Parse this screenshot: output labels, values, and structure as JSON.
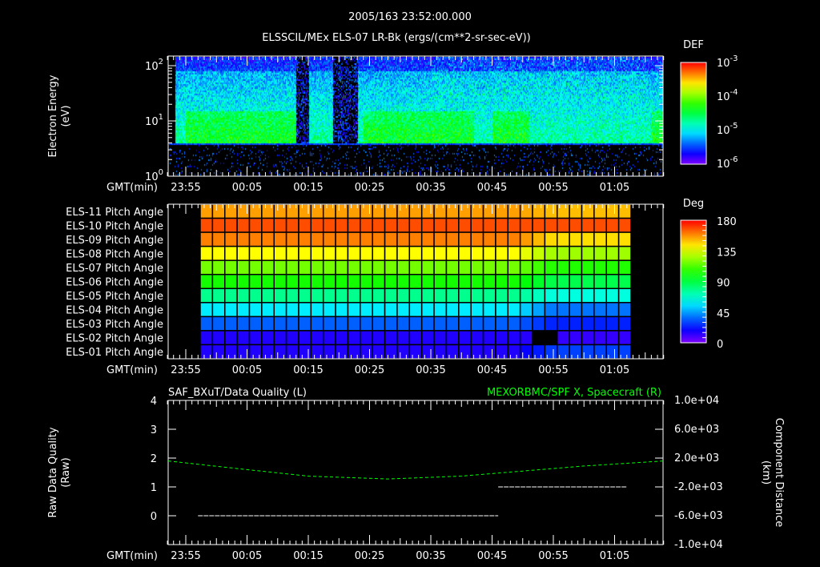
{
  "title": "2005/163 23:52:00.000",
  "chart_data": [
    {
      "type": "heatmap",
      "name": "spectrogram",
      "title": "ELSSCIL/MEx ELS-07 LR-Bk  (ergs/(cm**2-sr-sec-eV))",
      "ylabel": [
        "Electron Energy",
        "(eV)"
      ],
      "xlabel": "GMT(min)",
      "yscale": "log",
      "ylim": [
        1,
        150
      ],
      "yticks": [
        {
          "base": "10",
          "exp": "0",
          "v": 1
        },
        {
          "base": "10",
          "exp": "1",
          "v": 10
        },
        {
          "base": "10",
          "exp": "2",
          "v": 100
        }
      ],
      "xlim_min": [
        -3,
        78
      ],
      "xticks": [
        "23:55",
        "00:05",
        "00:15",
        "00:25",
        "00:35",
        "00:45",
        "00:55",
        "01:05"
      ],
      "colorbar": {
        "label": "DEF",
        "scale": "log",
        "range": [
          1e-06,
          0.001
        ],
        "ticks": [
          {
            "base": "10",
            "exp": "-3"
          },
          {
            "base": "10",
            "exp": "-4"
          },
          {
            "base": "10",
            "exp": "-5"
          },
          {
            "base": "10",
            "exp": "-6"
          }
        ]
      },
      "gaps_min": [
        [
          18,
          20
        ],
        [
          24,
          28
        ]
      ],
      "enhanced_min": [
        [
          0,
          18
        ],
        [
          29,
          47
        ],
        [
          50,
          56
        ],
        [
          76,
          78
        ]
      ]
    },
    {
      "type": "heatmap",
      "name": "pitch-angle",
      "xlabel": "GMT(min)",
      "rows": [
        "ELS-11 Pitch Angle",
        "ELS-10 Pitch Angle",
        "ELS-09 Pitch Angle",
        "ELS-08 Pitch Angle",
        "ELS-07 Pitch Angle",
        "ELS-06 Pitch Angle",
        "ELS-05 Pitch Angle",
        "ELS-04 Pitch Angle",
        "ELS-03 Pitch Angle",
        "ELS-02 Pitch Angle",
        "ELS-01 Pitch Angle"
      ],
      "values_before": [
        155,
        168,
        160,
        140,
        118,
        103,
        78,
        57,
        35,
        15,
        15
      ],
      "values_after": [
        150,
        168,
        145,
        125,
        105,
        88,
        65,
        38,
        25,
        12,
        30
      ],
      "change_min": 58,
      "data_range_min": [
        2,
        72
      ],
      "missing": {
        "row": "ELS-02 Pitch Angle",
        "range_min": [
          56.5,
          60
        ]
      },
      "colorbar": {
        "label": "Deg",
        "range": [
          0,
          180
        ],
        "ticks": [
          "180",
          "135",
          "90",
          "45",
          "0"
        ]
      },
      "xticks": [
        "23:55",
        "00:05",
        "00:15",
        "00:25",
        "00:35",
        "00:45",
        "00:55",
        "01:05"
      ]
    },
    {
      "type": "line",
      "name": "timeseries",
      "title_left": "SAF_BXuT/Data Quality (L)",
      "title_right": "MEXORBMC/SPF X, Spacecraft (R)",
      "ylabel_left": [
        "Raw Data Quality",
        "(Raw)"
      ],
      "ylabel_right": [
        "Component Distance",
        "(km)"
      ],
      "ylim_left": [
        -1,
        4
      ],
      "yticks_left": [
        "4",
        "3",
        "2",
        "1",
        "0"
      ],
      "ylim_right": [
        -10000,
        10000
      ],
      "yticks_right": [
        "1.0e+04",
        "6.0e+03",
        "2.0e+03",
        "-2.0e+03",
        "-6.0e+03",
        "-1.0e+04"
      ],
      "xlabel": "GMT(min)",
      "xticks": [
        "23:55",
        "00:05",
        "00:15",
        "00:25",
        "00:35",
        "00:45",
        "00:55",
        "01:05"
      ],
      "series": [
        {
          "name": "Data Quality",
          "axis": "left",
          "color": "#ffffff",
          "segments": [
            {
              "x": [
                2,
                51
              ],
              "y": 0
            },
            {
              "x": [
                51,
                72
              ],
              "y": 1
            }
          ]
        },
        {
          "name": "SPF X",
          "axis": "right",
          "color": "#00ff00",
          "style": "dashed",
          "x": [
            -3,
            10,
            20,
            33,
            45,
            55,
            65,
            78
          ],
          "y": [
            1600,
            400,
            -500,
            -900,
            -500,
            200,
            900,
            1600
          ]
        }
      ]
    }
  ]
}
